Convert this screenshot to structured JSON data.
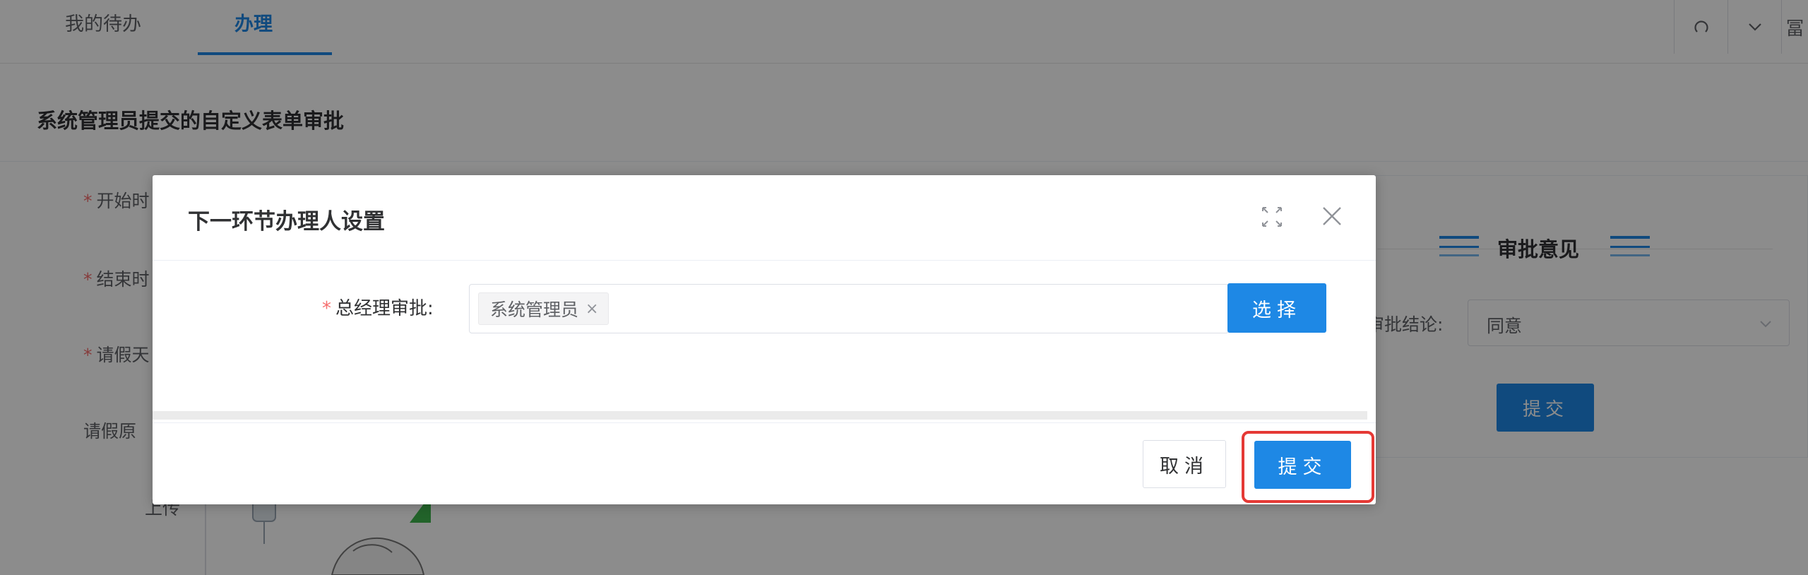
{
  "tabs": [
    {
      "label": "我的待办"
    },
    {
      "label": "办理"
    }
  ],
  "toolbar": {
    "refresh_icon": "refresh-icon",
    "dropdown_icon": "chevron-down-icon",
    "cut_glyph": "冨"
  },
  "page": {
    "title": "系统管理员提交的自定义表单审批",
    "form_labels": [
      {
        "required": true,
        "text": "开始时"
      },
      {
        "required": true,
        "text": "结束时"
      },
      {
        "required": true,
        "text": "请假天"
      },
      {
        "required": false,
        "text": "请假原"
      },
      {
        "required": false,
        "text": "上传"
      }
    ]
  },
  "opinion": {
    "title": "审批意见",
    "conclusion_label": "审批结论:",
    "conclusion_value": "同意",
    "submit_label": "提交"
  },
  "dialog": {
    "title": "下一环节办理人设置",
    "field_required_mark": "*",
    "field_label": "总经理审批:",
    "selected_tag": "系统管理员",
    "tag_close": "×",
    "choose_label": "选择",
    "cancel_label": "取消",
    "submit_label": "提交"
  },
  "colors": {
    "primary": "#1e88e5",
    "required": "#f56c6c",
    "highlight": "#e53935"
  }
}
